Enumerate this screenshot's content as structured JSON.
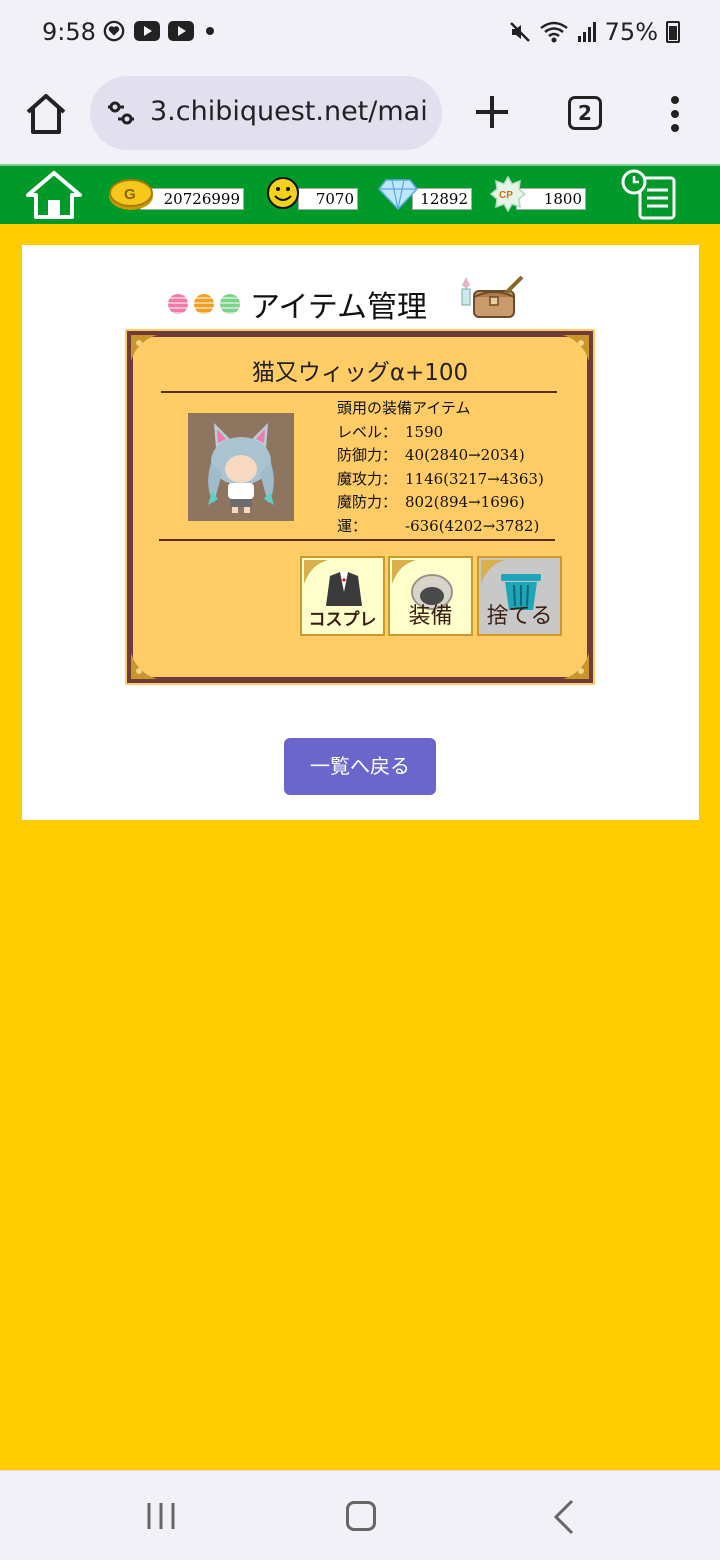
{
  "status": {
    "time": "9:58",
    "battery": "75%"
  },
  "browser": {
    "url": "3.chibiquest.net/mai",
    "tab_count": "2"
  },
  "header": {
    "gold": "20726999",
    "smile": "7070",
    "diamond": "12892",
    "cp": "1800",
    "cp_icon_text": "CP"
  },
  "page": {
    "title": "アイテム管理",
    "title_dot_colors": [
      "#f07aa8",
      "#f2a024",
      "#7ed38a"
    ]
  },
  "item": {
    "name": "猫又ウィッグα+100",
    "category": "頭用の装備アイテム",
    "stats": [
      {
        "label": "レベル：",
        "value": "1590"
      },
      {
        "label": "防御力：",
        "value": "40(2840→2034)"
      },
      {
        "label": "魔攻力：",
        "value": "1146(3217→4363)"
      },
      {
        "label": "魔防力：",
        "value": "802(894→1696)"
      },
      {
        "label": "運：",
        "value": "-636(4202→3782)"
      }
    ]
  },
  "actions": {
    "cosplay": "コスプレ",
    "equip": "装備",
    "discard": "捨てる"
  },
  "back_button": "一覧へ戻る",
  "colors": {
    "page_bg": "#ffcc00",
    "header_bg": "#009a2a",
    "card_bg": "#ffcc66",
    "card_border": "#6e3a3a",
    "button_bg": "#6a66cc"
  }
}
